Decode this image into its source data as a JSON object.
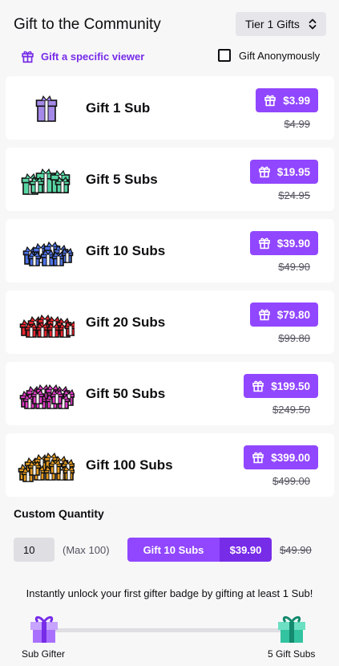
{
  "header": {
    "title": "Gift to the Community",
    "tier_select": "Tier 1 Gifts"
  },
  "options": {
    "specific_viewer": "Gift a specific viewer",
    "anonymous": "Gift Anonymously",
    "anonymous_checked": false
  },
  "gifts": [
    {
      "name": "Gift 1 Sub",
      "price": "$3.99",
      "old_price": "$4.99",
      "color": "#a489e8",
      "icon": "gift-box-icon"
    },
    {
      "name": "Gift 5 Subs",
      "price": "$19.95",
      "old_price": "$24.95",
      "color": "#58d6a4",
      "icon": "gift-box-pile-icon"
    },
    {
      "name": "Gift 10 Subs",
      "price": "$39.90",
      "old_price": "$49.90",
      "color": "#4d72e6",
      "icon": "gift-box-pile-icon"
    },
    {
      "name": "Gift 20 Subs",
      "price": "$79.80",
      "old_price": "$99.80",
      "color": "#e8262f",
      "icon": "gift-box-pile-icon"
    },
    {
      "name": "Gift 50 Subs",
      "price": "$199.50",
      "old_price": "$249.50",
      "color": "#e03cc6",
      "icon": "gift-box-pile-icon"
    },
    {
      "name": "Gift 100 Subs",
      "price": "$399.00",
      "old_price": "$499.00",
      "color": "#e39a1f",
      "icon": "gift-box-pile-icon"
    }
  ],
  "custom": {
    "label": "Custom Quantity",
    "quantity": "10",
    "max_note": "(Max 100)",
    "button_label": "Gift 10 Subs",
    "button_price": "$39.90",
    "old_price": "$49.90"
  },
  "badge": {
    "message": "Instantly unlock your first gifter badge by gifting at least 1 Sub!",
    "left_label": "Sub Gifter",
    "right_label": "5 Gift Subs",
    "left_color": "#a970ff",
    "right_color": "#33c3a0"
  },
  "colors": {
    "accent": "#9147ff",
    "accent_dark": "#772ce8"
  }
}
